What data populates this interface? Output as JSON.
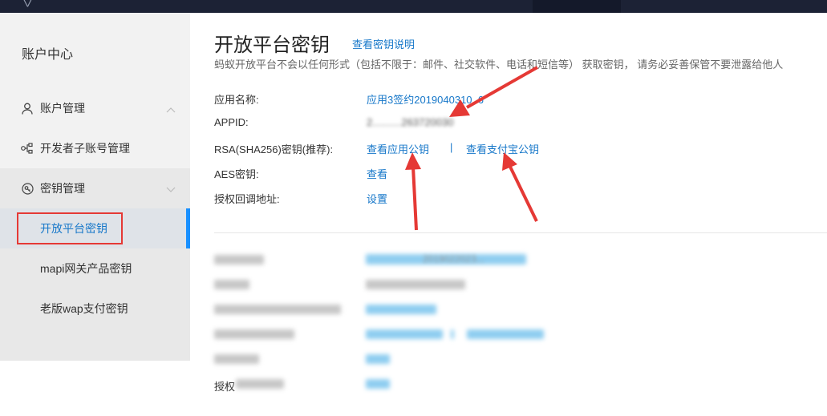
{
  "sidebar": {
    "title": "账户中心",
    "groups": [
      {
        "label": "账户管理",
        "icon": "user-icon"
      },
      {
        "label": "开发者子账号管理",
        "icon": "org-tree-icon"
      },
      {
        "label": "密钥管理",
        "icon": "key-icon"
      }
    ],
    "sub_items": [
      {
        "label": "开放平台密钥",
        "selected": true
      },
      {
        "label": "mapi网关产品密钥"
      },
      {
        "label": "老版wap支付密钥"
      }
    ]
  },
  "main": {
    "title": "开放平台密钥",
    "title_link": "查看密钥说明",
    "subtitle": "蚂蚁开放平台不会以任何形式（包括不限于：邮件、社交软件、电话和短信等） 获取密钥， 请务必妥善保管不要泄露给他人",
    "rows": [
      {
        "label": "应用名称:",
        "value": "应用3签约2019040310..6"
      },
      {
        "label": "APPID:",
        "value": "2..........263720030"
      },
      {
        "label": "RSA(SHA256)密钥(推荐):",
        "link1": "查看应用公钥",
        "separator": "|",
        "link2": "查看支付宝公钥"
      },
      {
        "label": "AES密钥:",
        "value": "查看"
      },
      {
        "label": "授权回调地址:",
        "value": "设置"
      }
    ],
    "lower_visible_text": {
      "first_value_tail": "2019022023...",
      "last_label_prefix": "授权"
    }
  },
  "colors": {
    "accent": "#1677c9",
    "topbar": "#1c2235",
    "sidebar_bg": "#f2f2f2",
    "arrow_red": "#e53935"
  }
}
